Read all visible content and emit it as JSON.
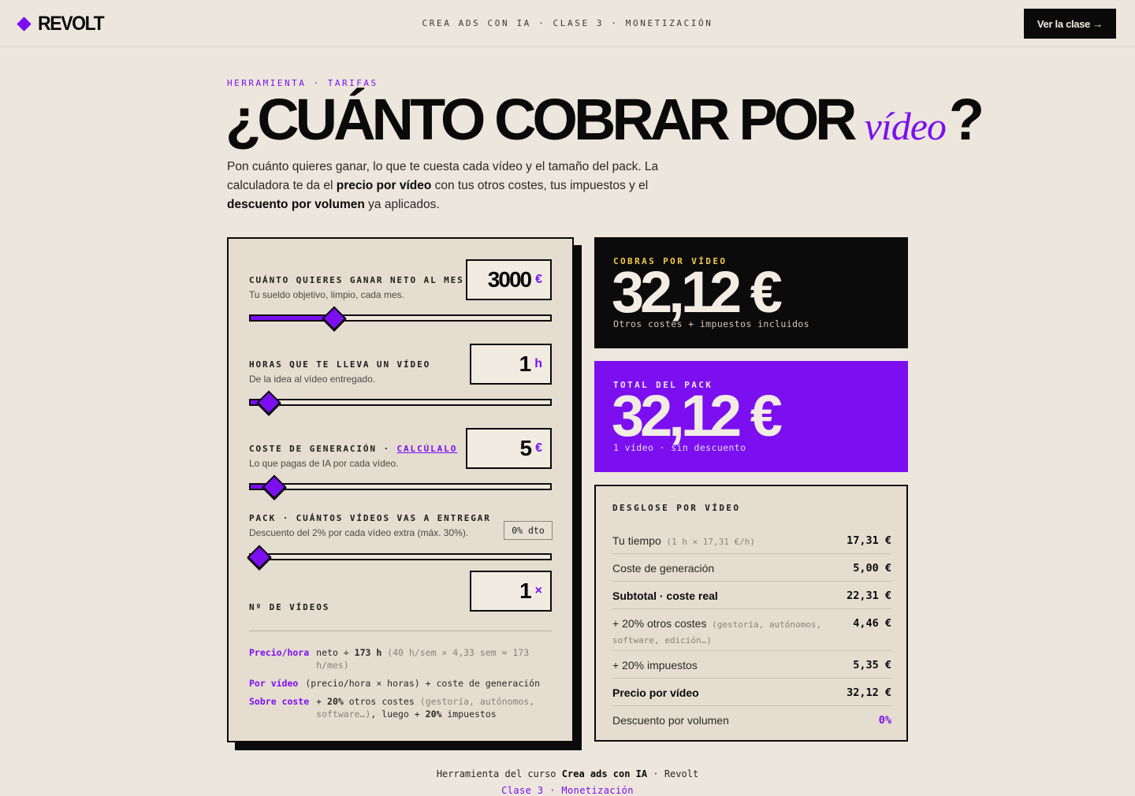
{
  "brand": {
    "name": "REVOLT",
    "accent": "#7b0ff0",
    "ink": "#0b0a0a",
    "background": "#ede6dc"
  },
  "header": {
    "breadcrumb": "CREA ADS CON IA · CLASE 3 · MONETIZACIÓN",
    "cta_label": "Ver la clase →"
  },
  "hero": {
    "eyebrow": "HERRAMIENTA · TARIFAS",
    "title_main": "¿CUÁNTO COBRAR POR",
    "title_accent": "vídeo",
    "title_end": "?",
    "intro_1": "Pon cuánto quieres ganar, lo que te cuesta cada vídeo y el tamaño del pack. La calculadora te da el ",
    "intro_b1": "precio por vídeo",
    "intro_2": " con tus otros costes, tus impuestos y el ",
    "intro_b2": "descuento por volumen",
    "intro_3": " ya aplicados."
  },
  "calculator": {
    "net_income": {
      "label": "CUÁNTO QUIERES GANAR NETO AL MES",
      "help": "Tu sueldo objetivo, limpio, cada mes.",
      "value": "3000",
      "unit": "€",
      "slider_fraction": 0.28
    },
    "hours": {
      "label": "HORAS QUE TE LLEVA UN VÍDEO",
      "help": "De la idea al vídeo entregado.",
      "value": "1",
      "unit": "h",
      "slider_fraction": 0.06
    },
    "generation_cost": {
      "label": "COSTE DE GENERACIÓN ·",
      "link": "CALCÚLALO",
      "help": "Lo que pagas de IA por cada vídeo.",
      "value": "5",
      "unit": "€",
      "slider_fraction": 0.08
    },
    "pack": {
      "label": "PACK · CUÁNTOS VÍDEOS VAS A ENTREGAR",
      "help": "Descuento del 2% por cada vídeo extra (máx. 30%).",
      "discount_chip": "0% dto",
      "slider_fraction": 0.03
    },
    "videos": {
      "label": "Nº DE VÍDEOS",
      "value": "1",
      "unit": "×"
    },
    "formulas": [
      {
        "key": "Precio/hora",
        "pre": "neto ÷ ",
        "bold": "173 h",
        "muted": " (40 h/sem × 4,33 sem ≈ 173 h/mes)",
        "post": ""
      },
      {
        "key": "Por vídeo",
        "pre": "(precio/hora × horas) + coste de generación",
        "bold": "",
        "muted": "",
        "post": ""
      },
      {
        "key": "Sobre coste",
        "pre": "+ ",
        "bold": "20%",
        "mid": " otros costes ",
        "muted": "(gestoría, autónomos, software…)",
        "post": ", luego + ",
        "bold2": "20%",
        "post2": " impuestos"
      }
    ]
  },
  "results": {
    "per_video": {
      "tag": "COBRAS POR VÍDEO",
      "value": "32,12 €",
      "sub": "Otros costes + impuestos incluidos"
    },
    "pack_total": {
      "tag": "TOTAL DEL PACK",
      "value": "32,12 €",
      "sub": "1 vídeo · sin descuento"
    }
  },
  "breakdown": {
    "title": "DESGLOSE POR VÍDEO",
    "rows": [
      {
        "label": "Tu tiempo",
        "note": " (1 h × 17,31 €/h)",
        "value": "17,31 €",
        "strong": false
      },
      {
        "label": "Coste de generación",
        "note": "",
        "value": "5,00 €",
        "strong": false
      },
      {
        "label": "Subtotal · coste real",
        "note": "",
        "value": "22,31 €",
        "strong": true
      },
      {
        "label": "+ 20% otros costes",
        "note": " (gestoría, autónomos, software, edición…)",
        "value": "4,46 €",
        "strong": false
      },
      {
        "label": "+ 20% impuestos",
        "note": "",
        "value": "5,35 €",
        "strong": false
      },
      {
        "label": "Precio por vídeo",
        "note": "",
        "value": "32,12 €",
        "strong": true
      },
      {
        "label": "Descuento por volumen",
        "note": "",
        "value": "0%",
        "strong": false,
        "accent": true
      }
    ]
  },
  "footer": {
    "pre": "Herramienta del curso ",
    "course": "Crea ads con IA",
    "post": " · Revolt",
    "line2": "Clase 3 · Monetización"
  }
}
